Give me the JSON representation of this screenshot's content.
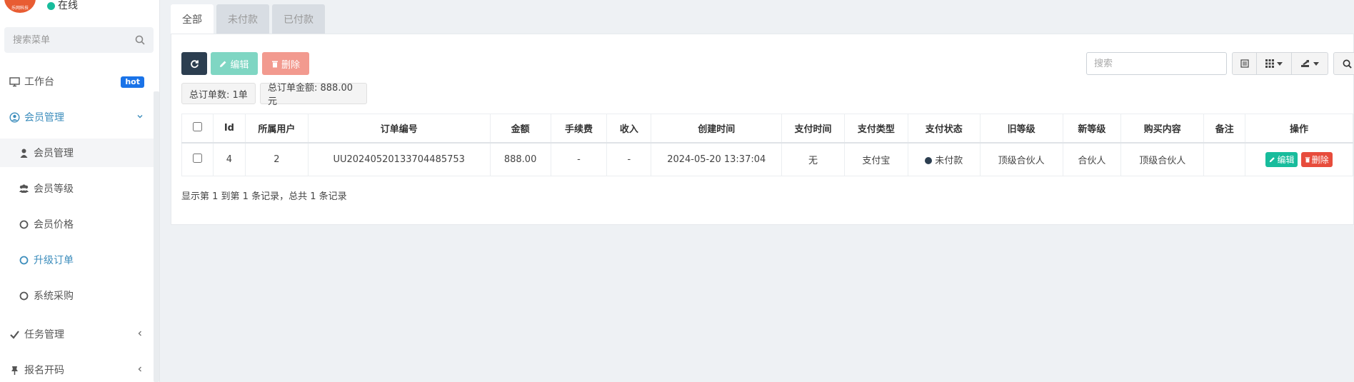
{
  "user": {
    "status": "在线",
    "avatar_text": "乐网科技"
  },
  "menu_search": {
    "placeholder": "搜索菜单"
  },
  "menu": {
    "dashboard": {
      "label": "工作台",
      "badge": "hot"
    },
    "member_mgmt": {
      "label": "会员管理"
    },
    "sub_member_mgmt": {
      "label": "会员管理"
    },
    "sub_member_level": {
      "label": "会员等级"
    },
    "sub_member_price": {
      "label": "会员价格"
    },
    "sub_upgrade_order": {
      "label": "升级订单"
    },
    "sub_system_purchase": {
      "label": "系统采购"
    },
    "task_mgmt": {
      "label": "任务管理"
    },
    "signup": {
      "label": "报名开码"
    }
  },
  "tabs": [
    {
      "label": "全部"
    },
    {
      "label": "未付款"
    },
    {
      "label": "已付款"
    }
  ],
  "toolbar": {
    "edit_label": "编辑",
    "delete_label": "删除"
  },
  "summary": {
    "count": "总订单数: 1单",
    "amount": "总订单金额: 888.00元"
  },
  "search": {
    "placeholder": "搜索"
  },
  "table": {
    "headers": [
      "Id",
      "所属用户",
      "订单编号",
      "金额",
      "手续费",
      "收入",
      "创建时间",
      "支付时间",
      "支付类型",
      "支付状态",
      "旧等级",
      "新等级",
      "购买内容",
      "备注",
      "操作"
    ],
    "rows": [
      {
        "id": "4",
        "user": "2",
        "order_no": "UU20240520133704485753",
        "amount": "888.00",
        "fee": "-",
        "income": "-",
        "created": "2024-05-20 13:37:04",
        "paid_time": "无",
        "pay_type": "支付宝",
        "pay_status": "未付款",
        "old_level": "顶级合伙人",
        "new_level": "合伙人",
        "content": "顶级合伙人",
        "remark": "",
        "op_edit": "编辑",
        "op_delete": "删除"
      }
    ]
  },
  "pager": {
    "text": "显示第 1 到第 1 条记录，总共 1 条记录"
  },
  "colors": {
    "accent": "#3c8dbc",
    "success": "#18bc9c",
    "danger": "#e74c3c",
    "navy": "#2c3e50"
  }
}
